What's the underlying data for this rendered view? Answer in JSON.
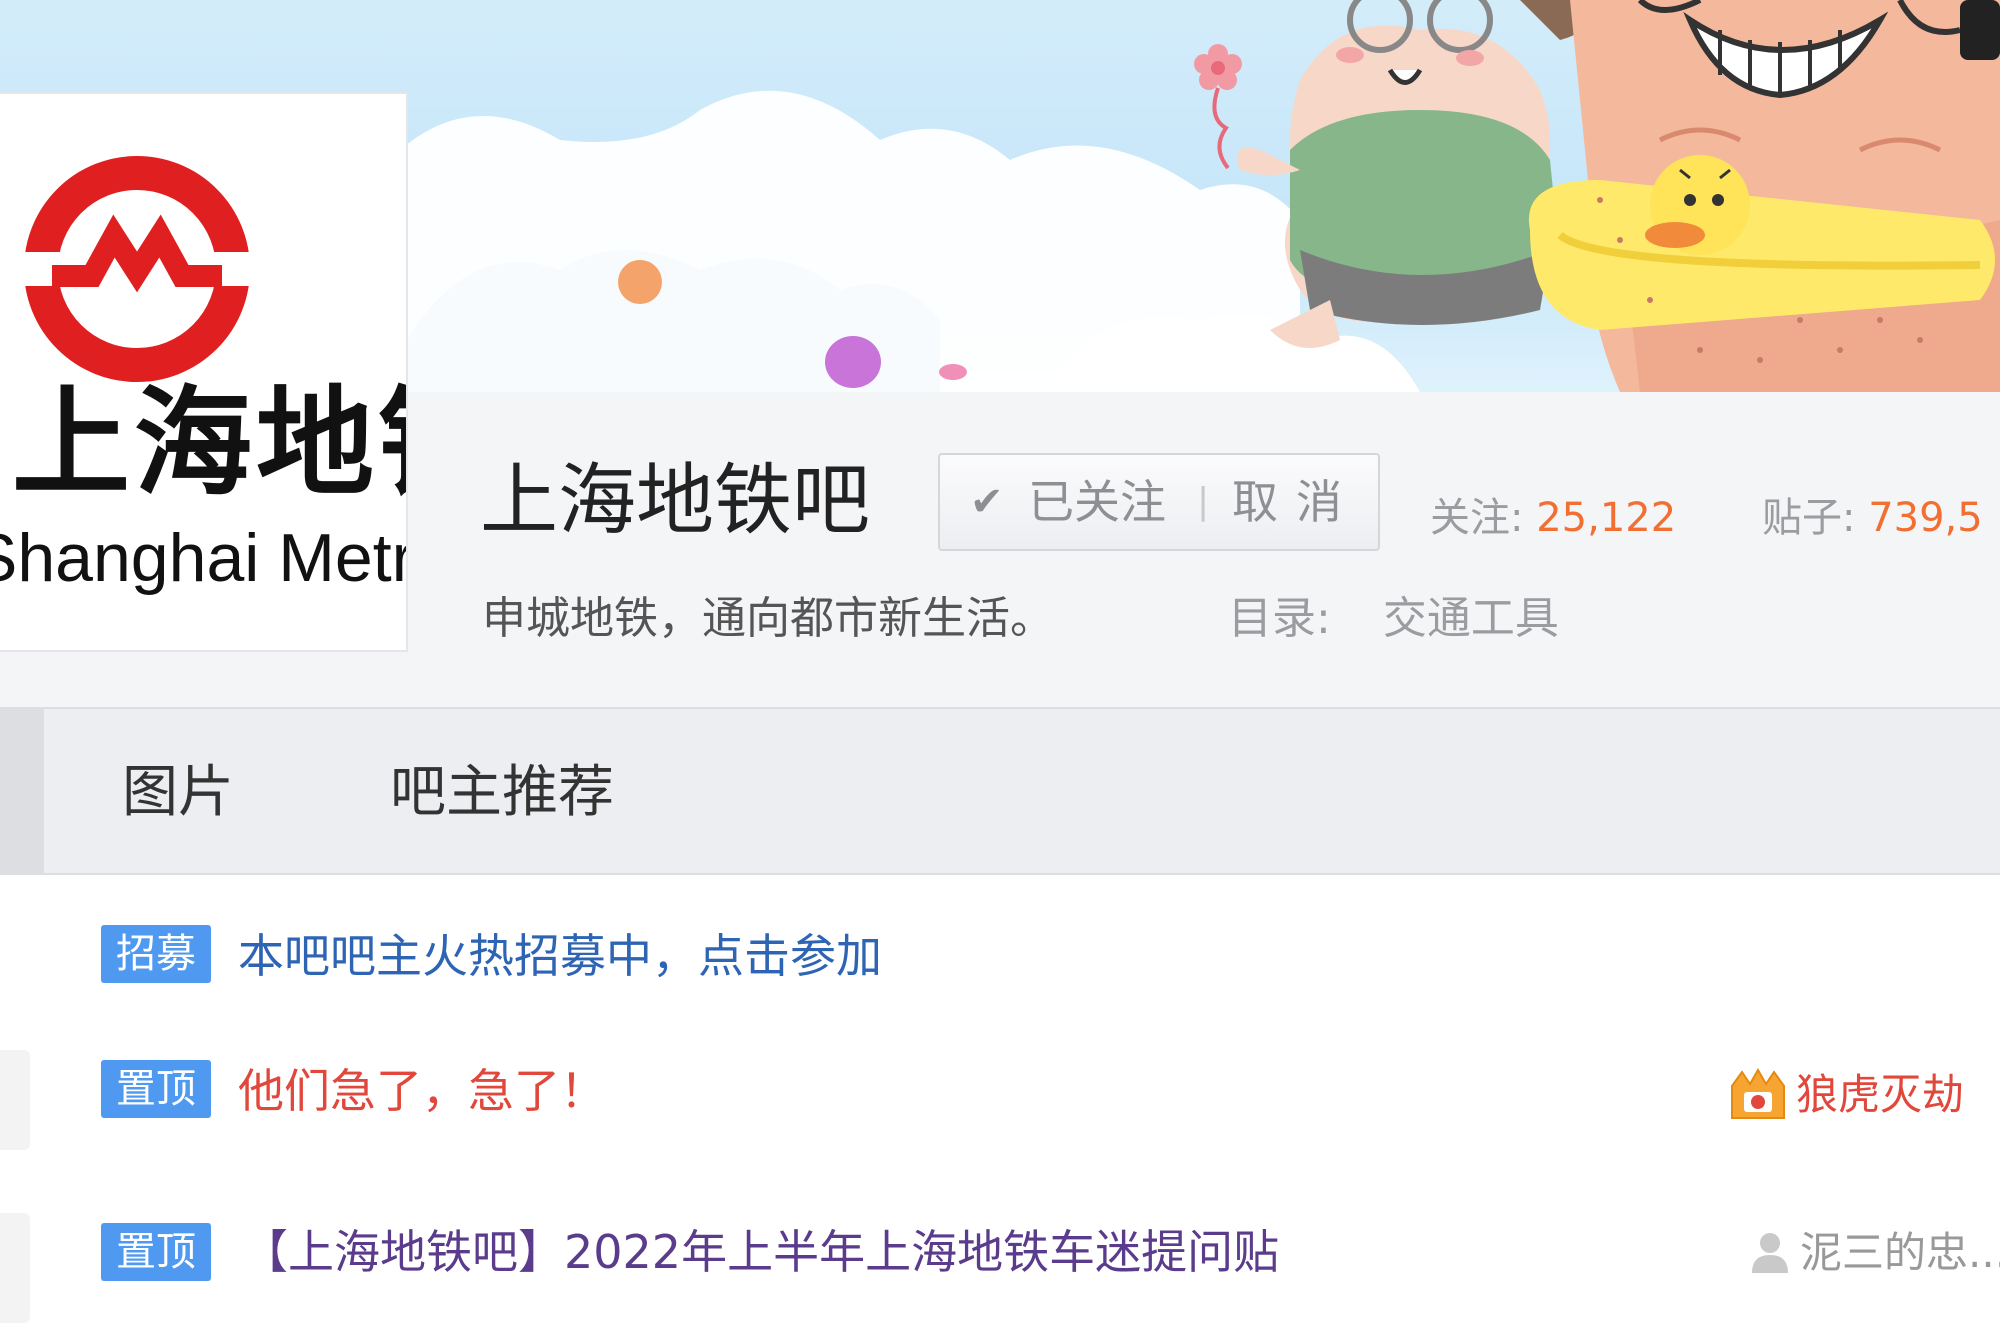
{
  "forum": {
    "logo": {
      "cn_text": "上海地铁",
      "en_text": "Shanghai Metro",
      "brand_color": "#e02020"
    },
    "title": "上海地铁吧",
    "follow_button": {
      "check_icon": "check-icon",
      "followed_label": "已关注",
      "separator": "|",
      "cancel_label": "取消"
    },
    "stats": {
      "follow_label": "关注:",
      "follow_value": "25,122",
      "posts_label": "贴子:",
      "posts_value": "739,5"
    },
    "slogan": "申城地铁，通向都市新生活。",
    "catalog_label": "目录:",
    "catalog_value": "交通工具"
  },
  "tabs": [
    {
      "label": "图片"
    },
    {
      "label": "吧主推荐"
    }
  ],
  "threads": [
    {
      "badge": "招募",
      "title": "本吧吧主火热招募中，点击参加",
      "style": "link",
      "author": ""
    },
    {
      "badge": "置顶",
      "title": "他们急了，急了！",
      "style": "hot",
      "author": "狼虎灭劫",
      "author_icon": "crown-icon"
    },
    {
      "badge": "置顶",
      "title": "【上海地铁吧】2022年上半年上海地铁车迷提问贴",
      "style": "normal",
      "author": "泥三的忠...",
      "author_icon": "user-icon"
    }
  ],
  "colors": {
    "accent_orange": "#f26f33",
    "badge_blue": "#4f9af0",
    "link_blue": "#2d64b3",
    "hot_red": "#e1483b",
    "thread_purple": "#5b3b8c"
  }
}
